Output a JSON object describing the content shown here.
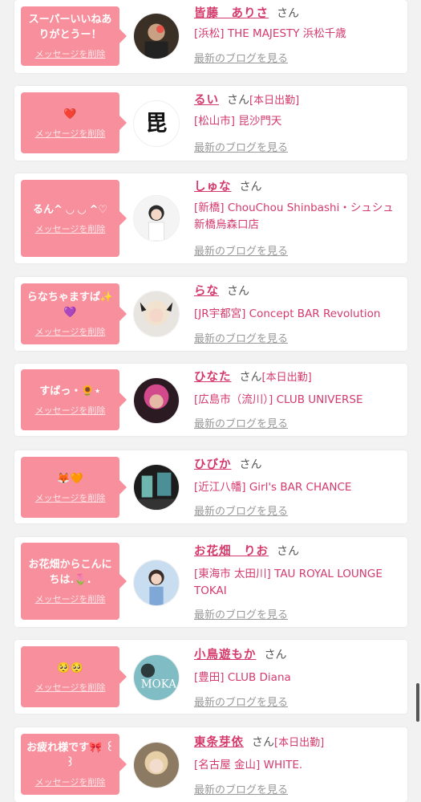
{
  "delete_label": "メッセージを削除",
  "blog_label": "最新のブログを見る",
  "honorific": "さん",
  "messages": [
    {
      "message": "スーパーいいねありがとうー！",
      "name": "皆藤　ありさ",
      "working": "",
      "shop": "[浜松] THE MAJESTY 浜松千歳",
      "avatar": "avatar-arisa"
    },
    {
      "message": "❤️",
      "name": "るい",
      "working": "[本日出勤]",
      "shop": "[松山市] 昆沙門天",
      "avatar": "avatar-rui-logo"
    },
    {
      "message": "るん^ ◡ ◡ ^♡",
      "name": "しゅな",
      "working": "",
      "shop": "[新橋] ChouChou Shinbashi・シュシュ新橋烏森口店",
      "avatar": "avatar-shuna"
    },
    {
      "message": "らなちゃますぱ✨💜",
      "name": "らな",
      "working": "",
      "shop": "[JR宇都宮] Concept BAR Revolution",
      "avatar": "avatar-rana"
    },
    {
      "message": "すばっ・🌻⋆",
      "name": "ひなた",
      "working": "[本日出勤]",
      "shop": "[広島市（流川）] CLUB UNIVERSE",
      "avatar": "avatar-hinata"
    },
    {
      "message": "🦊🧡",
      "name": "ひびか",
      "working": "",
      "shop": "[近江八幡] Girl's BAR CHANCE",
      "avatar": "avatar-hibika"
    },
    {
      "message": "お花畑からこんにちは.🌷.",
      "name": "お花畑　りお",
      "working": "",
      "shop": "[東海市 太田川] TAU ROYAL LOUNGE TOKAI",
      "avatar": "avatar-rio"
    },
    {
      "message": "🥺🥺",
      "name": "小鳥遊もか",
      "working": "",
      "shop": "[豊田] CLUB Diana",
      "avatar": "avatar-moka",
      "avatar_text": "MOKA"
    },
    {
      "message": "お疲れ様です🎀 ꒰ ꒱",
      "name": "東条芽依",
      "working": "[本日出勤]",
      "shop": "[名古屋 金山] WHITE.",
      "avatar": "avatar-mei"
    }
  ]
}
